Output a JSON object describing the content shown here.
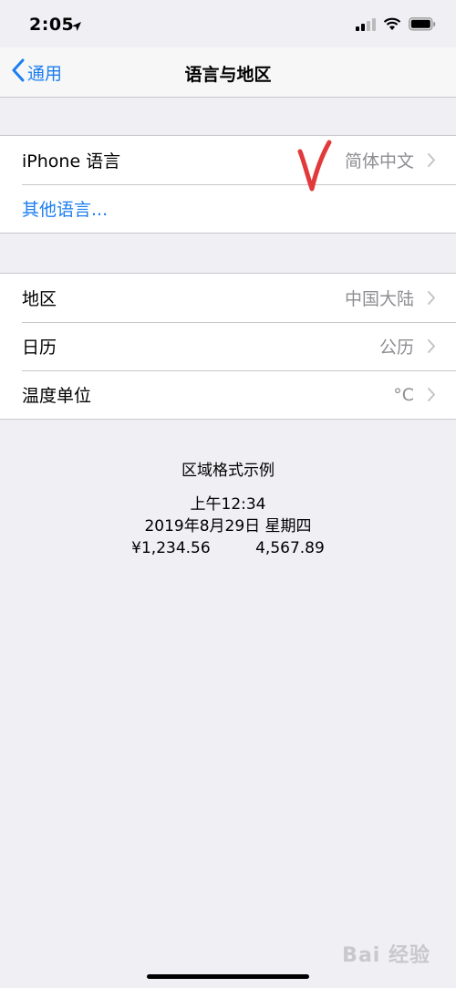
{
  "status_bar": {
    "time": "2:05",
    "icons": [
      "location-arrow-icon",
      "cellular-signal-icon",
      "wifi-icon",
      "battery-icon"
    ]
  },
  "nav": {
    "back_label": "通用",
    "title": "语言与地区",
    "accent_color": "#1b7ef0"
  },
  "language_group": {
    "iphone_language_label": "iPhone 语言",
    "iphone_language_value": "简体中文",
    "other_languages_label": "其他语言..."
  },
  "region_group": {
    "items": [
      {
        "label": "地区",
        "value": "中国大陆"
      },
      {
        "label": "日历",
        "value": "公历"
      },
      {
        "label": "温度单位",
        "value": "°C"
      }
    ]
  },
  "format_example": {
    "title": "区域格式示例",
    "time": "上午12:34",
    "date": "2019年8月29日 星期四",
    "currency": "¥1,234.56",
    "number": "4,567.89"
  },
  "watermark": {
    "text": "Bai 经验"
  }
}
